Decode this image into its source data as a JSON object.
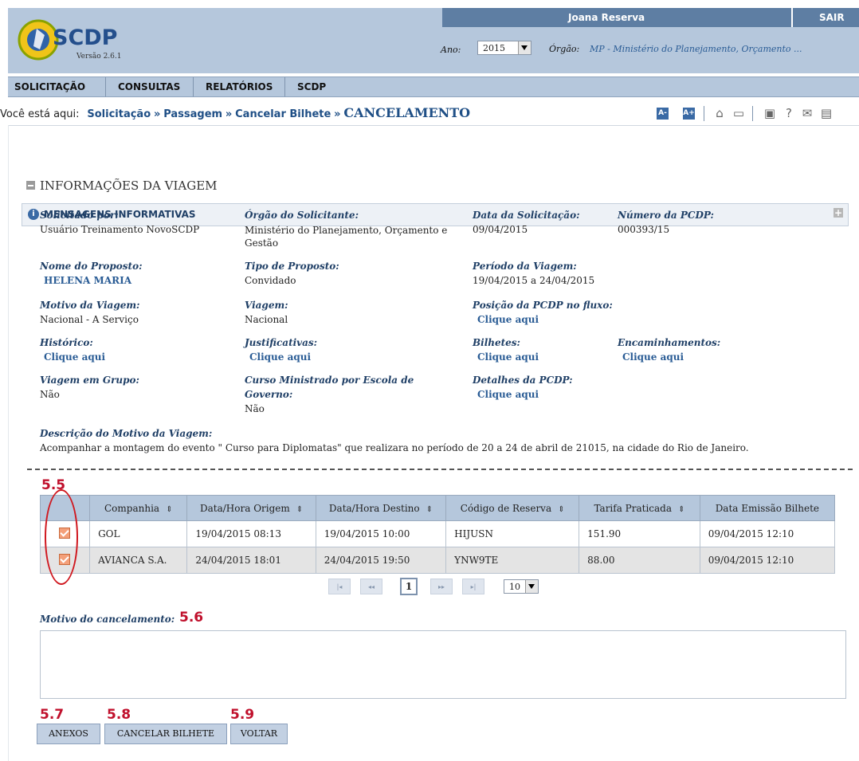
{
  "header": {
    "user_name": "Joana Reserva",
    "logout_label": "SAIR",
    "app_name": "SCDP",
    "version": "Versão 2.6.1",
    "year_label": "Ano:",
    "year_value": "2015",
    "org_label": "Órgão:",
    "org_value": "MP - Ministério do Planejamento, Orçamento ..."
  },
  "menu": {
    "items": [
      {
        "label": "SOLICITAÇÃO"
      },
      {
        "label": "CONSULTAS"
      },
      {
        "label": "RELATÓRIOS"
      },
      {
        "label": "SCDP"
      }
    ]
  },
  "breadcrumb": {
    "prefix": "Você está aqui:",
    "items": [
      "Solicitação",
      "Passagem",
      "Cancelar Bilhete"
    ],
    "current": "CANCELAMENTO",
    "separator": "»"
  },
  "toolbar": {
    "font_decrease": "A-",
    "font_increase": "A+",
    "icons": [
      "home-icon",
      "chat-icon",
      "video-icon",
      "help-icon",
      "mail-icon",
      "feedback-icon"
    ]
  },
  "messages_panel": {
    "title": "MENSAGENS INFORMATIVAS"
  },
  "trip_info": {
    "title": "INFORMAÇÕES DA VIAGEM",
    "requested_by_label": "Solicitado por:",
    "requested_by_value": "Usuário Treinamento NovoSCDP",
    "requester_org_label": "Órgão do Solicitante:",
    "requester_org_value": "Ministério do Planejamento, Orçamento e Gestão",
    "request_date_label": "Data da Solicitação:",
    "request_date_value": "09/04/2015",
    "pcdp_number_label": "Número da PCDP:",
    "pcdp_number_value": "000393/15",
    "proposed_name_label": "Nome do Proposto:",
    "proposed_name_value": "HELENA MARIA",
    "proposed_type_label": "Tipo de Proposto:",
    "proposed_type_value": "Convidado",
    "trip_period_label": "Período da Viagem:",
    "trip_period_value": "19/04/2015 a 24/04/2015",
    "trip_reason_label": "Motivo da Viagem:",
    "trip_reason_value": "Nacional - A Serviço",
    "trip_label": "Viagem:",
    "trip_value": "Nacional",
    "pcdp_position_label": "Posição da PCDP no fluxo:",
    "click_here": "Clique aqui",
    "history_label": "Histórico:",
    "justifications_label": "Justificativas:",
    "tickets_label": "Bilhetes:",
    "forwardings_label": "Encaminhamentos:",
    "group_trip_label": "Viagem em Grupo:",
    "group_trip_value": "Não",
    "course_label_line1": "Curso Ministrado por Escola de",
    "course_label_line2": "Governo:",
    "course_value": "Não",
    "pcdp_details_label": "Detalhes da PCDP:",
    "reason_desc_label": "Descrição do Motivo da Viagem:",
    "reason_desc_value": "Acompanhar a montagem do evento \" Curso para Diplomatas\" que realizara no período de 20 a 24 de abril de 21015, na cidade do Rio de Janeiro."
  },
  "tickets_table": {
    "columns": [
      "Companhia",
      "Data/Hora Origem",
      "Data/Hora Destino",
      "Código de Reserva",
      "Tarifa Praticada",
      "Data Emissão Bilhete"
    ],
    "rows": [
      {
        "airline": "GOL",
        "origin": "19/04/2015 08:13",
        "destination": "19/04/2015 10:00",
        "code": "HIJUSN",
        "fare": "151.90",
        "issued": "09/04/2015 12:10",
        "checked": true
      },
      {
        "airline": "AVIANCA S.A.",
        "origin": "24/04/2015 18:01",
        "destination": "24/04/2015 19:50",
        "code": "YNW9TE",
        "fare": "88.00",
        "issued": "09/04/2015 12:10",
        "checked": true
      }
    ]
  },
  "pagination": {
    "first": "|◂",
    "prev": "◂◂",
    "current_page": "1",
    "next": "▸▸",
    "last": "▸|",
    "page_size": "10"
  },
  "cancel_reason": {
    "label": "Motivo do cancelamento:",
    "value": ""
  },
  "buttons": {
    "attachments": "ANEXOS",
    "cancel_ticket": "CANCELAR BILHETE",
    "back": "VOLTAR"
  },
  "annotations": {
    "a55": "5.5",
    "a56": "5.6",
    "a57": "5.7",
    "a58": "5.8",
    "a59": "5.9",
    "accent_color": "#c0102c"
  }
}
